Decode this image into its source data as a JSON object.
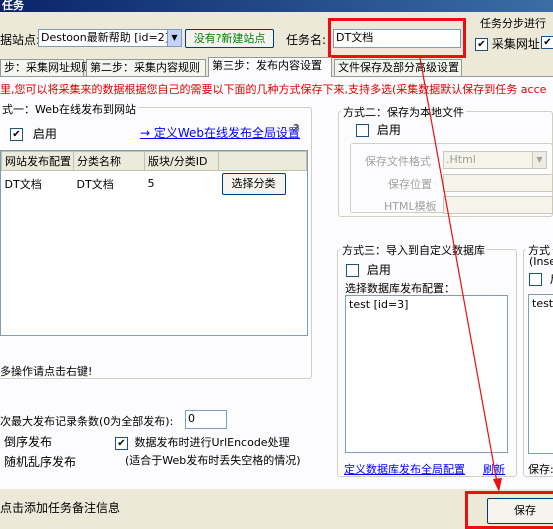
{
  "window": {
    "title": "任务"
  },
  "top": {
    "site_label": "据站点:",
    "site_value": "Destoon最新帮助 [id=2]",
    "new_site_button": "没有?新建站点",
    "task_name_label": "任务名:",
    "task_name_value": "DT文档",
    "steps_group_title": "任务分步进行",
    "steps_collect_url": "采集网址"
  },
  "tabs": [
    {
      "label": "步：采集网址规则"
    },
    {
      "label": "第二步：采集内容规则"
    },
    {
      "label": "第三步：发布内容设置"
    },
    {
      "label": "文件保存及部分高级设置"
    }
  ],
  "notice": "里,您可以将采集来的数据根据您自己的需要以下面的几种方式保存下来,支持多选(采集数据默认保存到任务 acce",
  "method1": {
    "title": "式一：Web在线发布到网站",
    "enable_label": "启用",
    "enabled": true,
    "global_link": "→ 定义Web在线发布全局设置",
    "help_icon": "?",
    "columns": [
      "网站发布配置",
      "分类名称",
      "版块/分类ID",
      ""
    ],
    "rows": [
      {
        "config": "DT文档",
        "category": "DT文档",
        "id": "5",
        "button": "选择分类"
      }
    ],
    "hint": "多操作请点击右键!"
  },
  "method2": {
    "title": "方式二：保存为本地文件",
    "enable_label": "启用",
    "format_label": "保存文件格式",
    "format_value": ".Html",
    "location_label": "保存位置",
    "template_label": "HTML模板"
  },
  "method3": {
    "title": "方式三：导入到自定义数据库",
    "enable_label": "启用",
    "select_label": "选择数据库发布配置：",
    "list_items": [
      "test [id=3]"
    ],
    "global_link": "定义数据库发布全局配置",
    "refresh_link": "刷新"
  },
  "method4": {
    "title": "方式",
    "subtitle": "(Inse",
    "enable_label": "启",
    "list_item": "test",
    "save_label": "保存:"
  },
  "bottom": {
    "max_records_label": "次最大发布记录条数(0为全部发布):",
    "max_records_value": "0",
    "reverse_label": "倒序发布",
    "random_label": "随机乱序发布",
    "urlencode_label": "数据发布时进行UrlEncode处理",
    "urlencode_checked": true,
    "urlencode_note": "(适合于Web发布时丢失空格的情况)"
  },
  "footer": {
    "note": "点击添加任务备注信息",
    "save_button": "保存"
  }
}
